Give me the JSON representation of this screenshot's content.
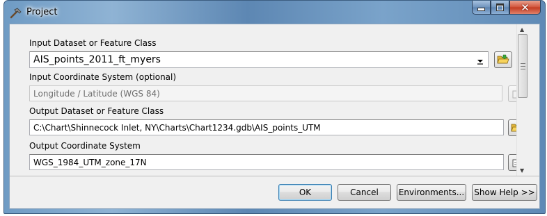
{
  "window": {
    "title": "Project",
    "controls": {
      "minimize_icon": "minimize-icon",
      "maximize_icon": "maximize-icon",
      "close_icon": "close-icon"
    }
  },
  "form": {
    "input_dataset": {
      "label": "Input Dataset or Feature Class",
      "value": "AIS_points_2011_ft_myers"
    },
    "input_coord": {
      "label": "Input Coordinate System (optional)",
      "value": "Longitude / Latitude (WGS 84)"
    },
    "output_dataset": {
      "label": "Output Dataset or Feature Class",
      "value": "C:\\Chart\\Shinnecock Inlet, NY\\Charts\\Chart1234.gdb\\AIS_points_UTM"
    },
    "output_coord": {
      "label": "Output Coordinate System",
      "value": "WGS_1984_UTM_zone_17N"
    }
  },
  "buttons": {
    "ok": "OK",
    "cancel": "Cancel",
    "environments": "Environments...",
    "show_help": "Show Help >>"
  },
  "colors": {
    "title_bar": "#6f9bc4",
    "close_button": "#c94328",
    "dialog_background": "#f0f0f0"
  }
}
